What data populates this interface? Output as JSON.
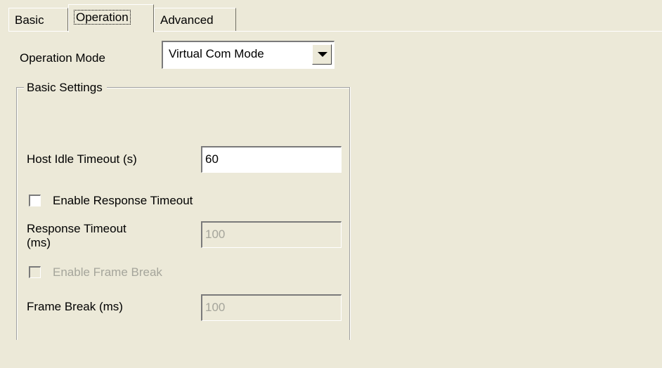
{
  "tabs": [
    {
      "label": "Basic"
    },
    {
      "label": "Operation"
    },
    {
      "label": "Advanced"
    }
  ],
  "operation_mode": {
    "label": "Operation Mode",
    "value": "Virtual Com Mode"
  },
  "basic_settings": {
    "title": "Basic Settings",
    "host_idle_timeout": {
      "label": "Host Idle Timeout (s)",
      "value": "60"
    },
    "enable_response_timeout": {
      "label": "Enable Response Timeout",
      "checked": false
    },
    "response_timeout": {
      "label_line1": "Response Timeout",
      "label_line2": "(ms)",
      "value": "100",
      "disabled": true
    },
    "enable_frame_break": {
      "label": "Enable Frame Break",
      "checked": false,
      "disabled": true
    },
    "frame_break": {
      "label": "Frame Break (ms)",
      "value": "100",
      "disabled": true
    }
  }
}
